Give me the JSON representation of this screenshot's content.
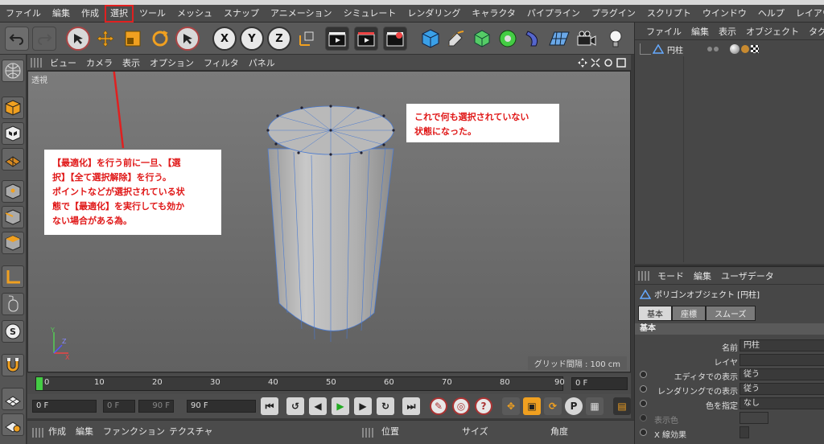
{
  "menubar": [
    "ファイル",
    "編集",
    "作成",
    "選択",
    "ツール",
    "メッシュ",
    "スナップ",
    "アニメーション",
    "シミュレート",
    "レンダリング",
    "キャラクタ",
    "パイプライン",
    "プラグイン",
    "スクリプト",
    "ウインドウ",
    "ヘルプ",
    "レイアウト"
  ],
  "highlighted_menu": "選択",
  "viewport": {
    "menu": [
      "ビュー",
      "カメラ",
      "表示",
      "オプション",
      "フィルタ",
      "パネル"
    ],
    "label": "透視",
    "grid": "グリッド間隔 : 100 cm",
    "axes": {
      "y": "Y",
      "z": "Z",
      "x": "X"
    }
  },
  "notes": {
    "left": [
      "【最適化】を行う前に一旦、【選",
      "択】【全て選択解除】を行う。",
      "ポイントなどが選択されている状",
      "態で【最適化】を実行しても効か",
      "ない場合がある為。"
    ],
    "right": [
      "これで何も選択されていない",
      "状態になった。"
    ]
  },
  "timeline": {
    "ticks": [
      "0",
      "10",
      "20",
      "30",
      "40",
      "50",
      "60",
      "70",
      "80",
      "90"
    ],
    "current": "0 F",
    "start": "0 F",
    "range_start": "0 F",
    "range_end": "90 F",
    "end": "90 F"
  },
  "bottom": {
    "left_menu": [
      "作成",
      "編集",
      "ファンクション",
      "テクスチャ"
    ],
    "coords": [
      "位置",
      "サイズ",
      "角度"
    ]
  },
  "objects": {
    "menu": [
      "ファイル",
      "編集",
      "表示",
      "オブジェクト",
      "タグ"
    ],
    "item": "円柱"
  },
  "attributes": {
    "menu": [
      "モード",
      "編集",
      "ユーザデータ"
    ],
    "title": "ポリゴンオブジェクト [円柱]",
    "tabs": [
      "基本",
      "座標",
      "スムーズ"
    ],
    "section": "基本",
    "rows": [
      {
        "label": "名前",
        "value": "円柱"
      },
      {
        "label": "レイヤ",
        "value": ""
      },
      {
        "label": "エディタでの表示",
        "value": "従う"
      },
      {
        "label": "レンダリングでの表示",
        "value": "従う"
      },
      {
        "label": "色を指定",
        "value": "なし"
      },
      {
        "label": "表示色",
        "value": ""
      },
      {
        "label": "X 線効果",
        "value": ""
      }
    ]
  }
}
